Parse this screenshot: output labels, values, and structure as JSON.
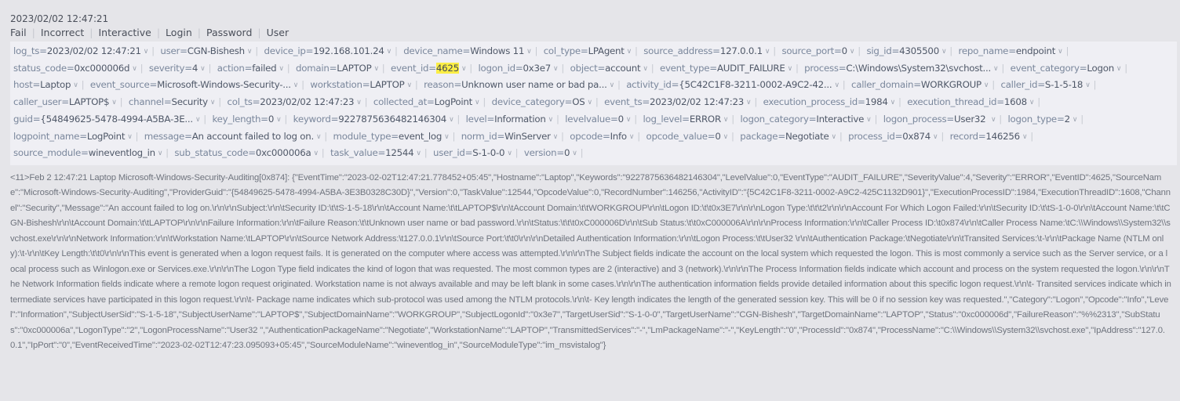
{
  "record": {
    "timestamp": "2023/02/02 12:47:21",
    "tags": [
      "Fail",
      "Incorrect",
      "Interactive",
      "Login",
      "Password",
      "User"
    ],
    "highlight_term": "4625",
    "fields": [
      {
        "key": "log_ts",
        "value": "2023/02/02 12:47:21"
      },
      {
        "key": "user",
        "value": "CGN-Bishesh"
      },
      {
        "key": "device_ip",
        "value": "192.168.101.24"
      },
      {
        "key": "device_name",
        "value": "Windows 11"
      },
      {
        "key": "col_type",
        "value": "LPAgent"
      },
      {
        "key": "source_address",
        "value": "127.0.0.1"
      },
      {
        "key": "source_port",
        "value": "0"
      },
      {
        "key": "sig_id",
        "value": "4305500"
      },
      {
        "key": "repo_name",
        "value": "endpoint"
      },
      {
        "key": "status_code",
        "value": "0xc000006d"
      },
      {
        "key": "severity",
        "value": "4"
      },
      {
        "key": "action",
        "value": "failed"
      },
      {
        "key": "domain",
        "value": "LAPTOP"
      },
      {
        "key": "event_id",
        "value": "4625",
        "highlight": true
      },
      {
        "key": "logon_id",
        "value": "0x3e7"
      },
      {
        "key": "object",
        "value": "account"
      },
      {
        "key": "event_type",
        "value": "AUDIT_FAILURE"
      },
      {
        "key": "process",
        "value": "C:\\Windows\\System32\\svchost..."
      },
      {
        "key": "event_category",
        "value": "Logon"
      },
      {
        "key": "host",
        "value": "Laptop"
      },
      {
        "key": "event_source",
        "value": "Microsoft-Windows-Security-..."
      },
      {
        "key": "workstation",
        "value": "LAPTOP"
      },
      {
        "key": "reason",
        "value": "Unknown user name or bad pa..."
      },
      {
        "key": "activity_id",
        "value": "{5C42C1F8-3211-0002-A9C2-42..."
      },
      {
        "key": "caller_domain",
        "value": "WORKGROUP"
      },
      {
        "key": "caller_id",
        "value": "S-1-5-18"
      },
      {
        "key": "caller_user",
        "value": "LAPTOP$"
      },
      {
        "key": "channel",
        "value": "Security"
      },
      {
        "key": "col_ts",
        "value": "2023/02/02 12:47:23"
      },
      {
        "key": "collected_at",
        "value": "LogPoint"
      },
      {
        "key": "device_category",
        "value": "OS"
      },
      {
        "key": "event_ts",
        "value": "2023/02/02 12:47:23"
      },
      {
        "key": "execution_process_id",
        "value": "1984"
      },
      {
        "key": "execution_thread_id",
        "value": "1608"
      },
      {
        "key": "guid",
        "value": "{54849625-5478-4994-A5BA-3E..."
      },
      {
        "key": "key_length",
        "value": "0"
      },
      {
        "key": "keyword",
        "value": "9227875636482146304"
      },
      {
        "key": "level",
        "value": "Information"
      },
      {
        "key": "levelvalue",
        "value": "0"
      },
      {
        "key": "log_level",
        "value": "ERROR"
      },
      {
        "key": "logon_category",
        "value": "Interactive"
      },
      {
        "key": "logon_process",
        "value": "User32 "
      },
      {
        "key": "logon_type",
        "value": "2"
      },
      {
        "key": "logpoint_name",
        "value": "LogPoint"
      },
      {
        "key": "message",
        "value": "An account failed to log on."
      },
      {
        "key": "module_type",
        "value": "event_log"
      },
      {
        "key": "norm_id",
        "value": "WinServer"
      },
      {
        "key": "opcode",
        "value": "Info"
      },
      {
        "key": "opcode_value",
        "value": "0"
      },
      {
        "key": "package",
        "value": "Negotiate"
      },
      {
        "key": "process_id",
        "value": "0x874"
      },
      {
        "key": "record",
        "value": "146256"
      },
      {
        "key": "source_module",
        "value": "wineventlog_in"
      },
      {
        "key": "sub_status_code",
        "value": "0xc000006a"
      },
      {
        "key": "task_value",
        "value": "12544"
      },
      {
        "key": "user_id",
        "value": "S-1-0-0"
      },
      {
        "key": "version",
        "value": "0"
      }
    ],
    "raw_log": "<11>Feb  2 12:47:21 Laptop Microsoft-Windows-Security-Auditing[0x874]: {\"EventTime\":\"2023-02-02T12:47:21.778452+05:45\",\"Hostname\":\"Laptop\",\"Keywords\":\"9227875636482146304\",\"LevelValue\":0,\"EventType\":\"AUDIT_FAILURE\",\"SeverityValue\":4,\"Severity\":\"ERROR\",\"EventID\":4625,\"SourceName\":\"Microsoft-Windows-Security-Auditing\",\"ProviderGuid\":\"{54849625-5478-4994-A5BA-3E3B0328C30D}\",\"Version\":0,\"TaskValue\":12544,\"OpcodeValue\":0,\"RecordNumber\":146256,\"ActivityID\":\"{5C42C1F8-3211-0002-A9C2-425C1132D901}\",\"ExecutionProcessID\":1984,\"ExecutionThreadID\":1608,\"Channel\":\"Security\",\"Message\":\"An account failed to log on.\\r\\n\\r\\nSubject:\\r\\n\\tSecurity ID:\\t\\tS-1-5-18\\r\\n\\tAccount Name:\\t\\tLAPTOP$\\r\\n\\tAccount Domain:\\t\\tWORKGROUP\\r\\n\\tLogon ID:\\t\\t0x3E7\\r\\n\\r\\nLogon Type:\\t\\t\\t2\\r\\n\\r\\nAccount For Which Logon Failed:\\r\\n\\tSecurity ID:\\t\\tS-1-0-0\\r\\n\\tAccount Name:\\t\\tCGN-Bishesh\\r\\n\\tAccount Domain:\\t\\tLAPTOP\\r\\n\\r\\nFailure Information:\\r\\n\\tFailure Reason:\\t\\tUnknown user name or bad password.\\r\\n\\tStatus:\\t\\t\\t0xC000006D\\r\\n\\tSub Status:\\t\\t0xC000006A\\r\\n\\r\\nProcess Information:\\r\\n\\tCaller Process ID:\\t0x874\\r\\n\\tCaller Process Name:\\tC:\\\\Windows\\\\System32\\\\svchost.exe\\r\\n\\r\\nNetwork Information:\\r\\n\\tWorkstation Name:\\tLAPTOP\\r\\n\\tSource Network Address:\\t127.0.0.1\\r\\n\\tSource Port:\\t\\t0\\r\\n\\r\\nDetailed Authentication Information:\\r\\n\\tLogon Process:\\t\\tUser32 \\r\\n\\tAuthentication Package:\\tNegotiate\\r\\n\\tTransited Services:\\t-\\r\\n\\tPackage Name (NTLM only):\\t-\\r\\n\\tKey Length:\\t\\t0\\r\\n\\r\\nThis event is generated when a logon request fails. It is generated on the computer where access was attempted.\\r\\n\\r\\nThe Subject fields indicate the account on the local system which requested the logon. This is most commonly a service such as the Server service, or a local process such as Winlogon.exe or Services.exe.\\r\\n\\r\\nThe Logon Type field indicates the kind of logon that was requested. The most common types are 2 (interactive) and 3 (network).\\r\\n\\r\\nThe Process Information fields indicate which account and process on the system requested the logon.\\r\\n\\r\\nThe Network Information fields indicate where a remote logon request originated. Workstation name is not always available and may be left blank in some cases.\\r\\n\\r\\nThe authentication information fields provide detailed information about this specific logon request.\\r\\n\\t- Transited services indicate which intermediate services have participated in this logon request.\\r\\n\\t- Package name indicates which sub-protocol was used among the NTLM protocols.\\r\\n\\t- Key length indicates the length of the generated session key. This will be 0 if no session key was requested.\",\"Category\":\"Logon\",\"Opcode\":\"Info\",\"Level\":\"Information\",\"SubjectUserSid\":\"S-1-5-18\",\"SubjectUserName\":\"LAPTOP$\",\"SubjectDomainName\":\"WORKGROUP\",\"SubjectLogonId\":\"0x3e7\",\"TargetUserSid\":\"S-1-0-0\",\"TargetUserName\":\"CGN-Bishesh\",\"TargetDomainName\":\"LAPTOP\",\"Status\":\"0xc000006d\",\"FailureReason\":\"%%2313\",\"SubStatus\":\"0xc000006a\",\"LogonType\":\"2\",\"LogonProcessName\":\"User32 \",\"AuthenticationPackageName\":\"Negotiate\",\"WorkstationName\":\"LAPTOP\",\"TransmittedServices\":\"-\",\"LmPackageName\":\"-\",\"KeyLength\":\"0\",\"ProcessId\":\"0x874\",\"ProcessName\":\"C:\\\\Windows\\\\System32\\\\svchost.exe\",\"IpAddress\":\"127.0.0.1\",\"IpPort\":\"0\",\"EventReceivedTime\":\"2023-02-02T12:47:23.095093+05:45\",\"SourceModuleName\":\"wineventlog_in\",\"SourceModuleType\":\"im_msvistalog\"}",
    "icons": {
      "field_menu": "chevron-down-icon",
      "chevron_glyph": "∨"
    },
    "separator": "|",
    "equals": "="
  }
}
